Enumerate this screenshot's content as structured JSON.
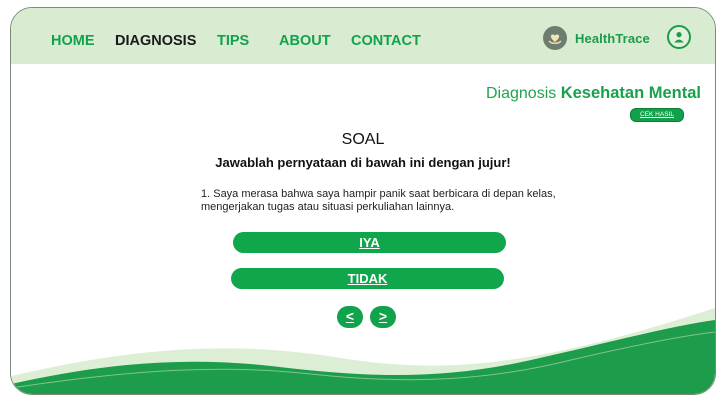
{
  "nav": {
    "items": [
      {
        "label": "HOME",
        "active": false
      },
      {
        "label": "DIAGNOSIS",
        "active": true
      },
      {
        "label": "TIPS",
        "active": false
      },
      {
        "label": "ABOUT",
        "active": false
      },
      {
        "label": "CONTACT",
        "active": false
      }
    ]
  },
  "brand": {
    "name": "HealthTrace",
    "logo_icon": "heart-hand-icon"
  },
  "user": {
    "icon": "user-icon"
  },
  "header": {
    "title_prefix": "Diagnosis",
    "title_bold": "Kesehatan Mental",
    "cek_hasil_label": "CEK HASIL"
  },
  "quiz": {
    "heading": "SOAL",
    "instruction": "Jawablah pernyataan di bawah ini dengan jujur!",
    "question_line1": "1. Saya merasa bahwa saya hampir panik saat berbicara di depan kelas,",
    "question_line2": "mengerjakan tugas atau situasi perkuliahan lainnya.",
    "answer_yes": "IYA",
    "answer_no": "TIDAK",
    "prev_label": "<",
    "next_label": ">"
  },
  "colors": {
    "accent": "#10a64b",
    "topbar": "#d9ecd1",
    "wave_light": "#dcefd5",
    "wave_dark": "#1d9c4c"
  }
}
